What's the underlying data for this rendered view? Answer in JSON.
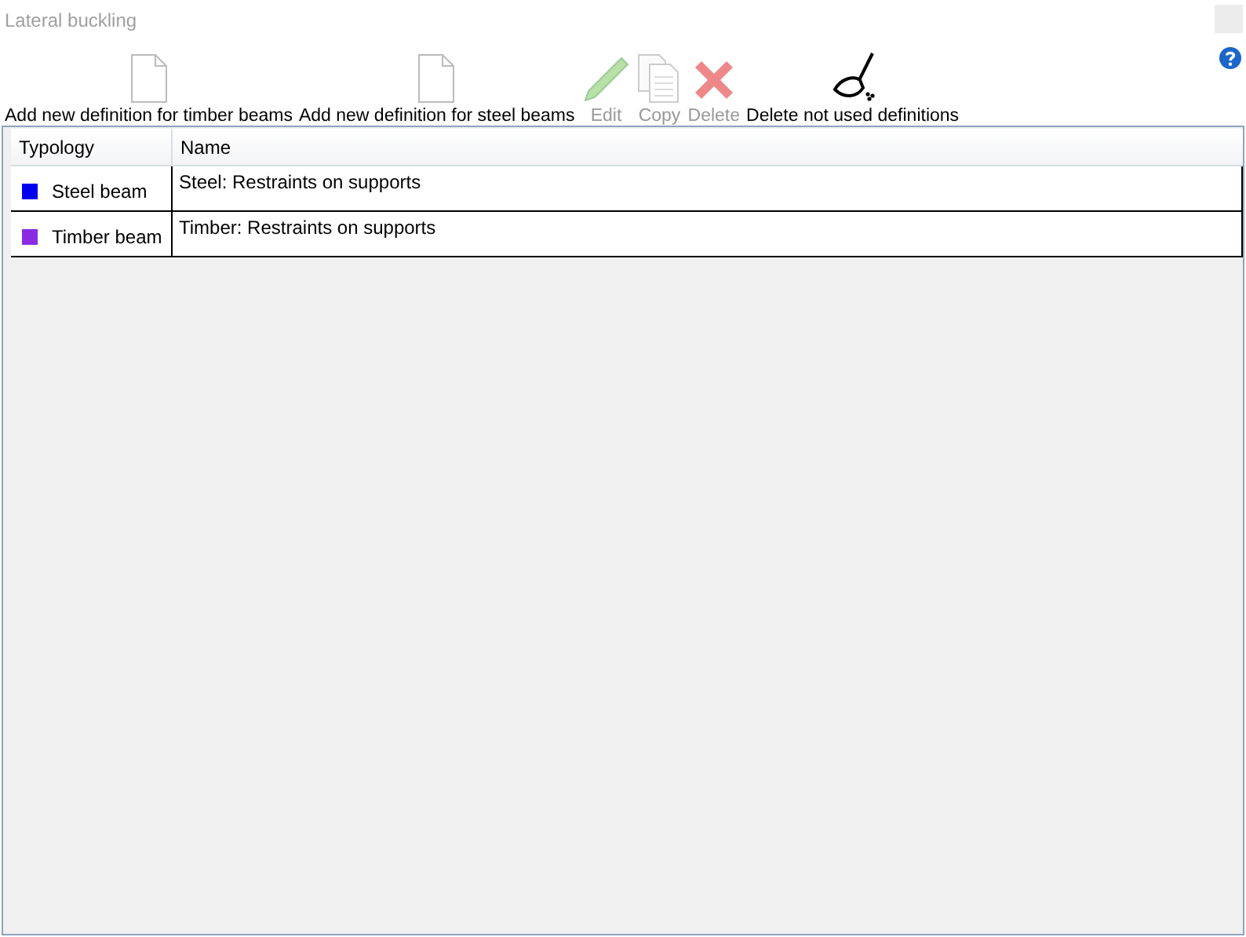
{
  "window": {
    "title": "Lateral buckling"
  },
  "toolbar": [
    {
      "label": "Add new definition for timber beams",
      "kind": "document",
      "disabled": false
    },
    {
      "label": "Add new definition for steel beams",
      "kind": "document",
      "disabled": false
    },
    {
      "label": "Edit",
      "kind": "pencil",
      "disabled": true
    },
    {
      "label": "Copy",
      "kind": "copy",
      "disabled": true
    },
    {
      "label": "Delete",
      "kind": "cross",
      "disabled": true
    },
    {
      "label": "Delete not used definitions",
      "kind": "broom",
      "disabled": false
    }
  ],
  "table": {
    "columns": [
      "Typology",
      "Name"
    ],
    "rows": [
      {
        "typology": "Steel beam",
        "color": "#0000ee",
        "name": "Steel: Restraints on supports"
      },
      {
        "typology": "Timber beam",
        "color": "#8a2be2",
        "name": "Timber: Restraints on supports"
      }
    ]
  }
}
